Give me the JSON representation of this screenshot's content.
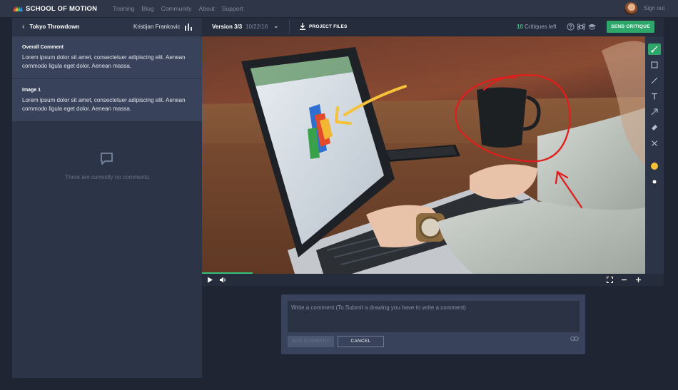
{
  "nav": {
    "brand": "SCHOOL OF MOTION",
    "links": [
      "Training",
      "Blog",
      "Community",
      "About",
      "Support"
    ],
    "signout": "Sign out"
  },
  "project": {
    "back_icon": "chevron-left-icon",
    "name": "Tokyo Throwdown",
    "author": "Kristijan Frankovic",
    "stats_icon": "bar-chart-icon"
  },
  "comments": [
    {
      "title": "Overall Comment",
      "text": "Lorem ipsum dolor sit amet, consectetuer adipiscing elit. Aenean commodo ligula eget dolor. Aenean massa."
    },
    {
      "title": "Image 1",
      "text": "Lorem ipsum dolor sit amet, consectetuer adipiscing elit. Aenean commodo ligula eget dolor. Aenean massa."
    }
  ],
  "empty_state": {
    "icon": "comment-bubble-icon",
    "text": "There are currently no comments"
  },
  "toolbar": {
    "version": "Version 3/3",
    "date": "10/22/16",
    "project_files": "PROJECT FILES",
    "critiques_count": "10",
    "critiques_label": " Critiques left",
    "send": "SEND CRITIQUE",
    "icons": [
      "help-icon",
      "command-icon",
      "graduation-cap-icon"
    ]
  },
  "draw_tools": [
    "brush-icon",
    "rectangle-icon",
    "line-icon",
    "text-icon",
    "arrow-icon",
    "eraser-icon",
    "clear-icon"
  ],
  "colors": {
    "accent": "#2ea66a",
    "annotation_yellow": "#f7c23a",
    "annotation_red": "#e01e1e",
    "panel": "#2c3547"
  },
  "player": {
    "progress_percent": 11,
    "icons": [
      "play-icon",
      "volume-icon",
      "fullscreen-icon",
      "zoom-out-icon",
      "zoom-in-icon"
    ]
  },
  "comment_form": {
    "placeholder": "Write a comment (To Submit a drawing you have to write a comment)",
    "add": "ADD COMMENT",
    "cancel": "CANCEL"
  }
}
